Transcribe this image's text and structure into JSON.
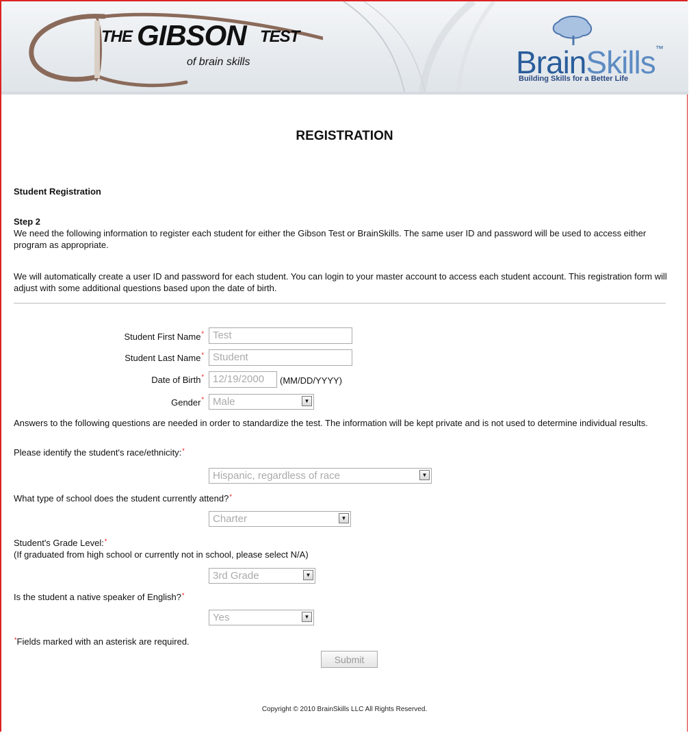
{
  "header": {
    "gibson_the": "THE",
    "gibson_name": "GIBSON",
    "gibson_test": "TEST",
    "gibson_sub": "of brain skills",
    "brainskills_brain": "Brain",
    "brainskills_skills": "Skills",
    "brainskills_tm": "™",
    "brainskills_tagline": "Building Skills for a Better Life"
  },
  "page": {
    "title": "REGISTRATION",
    "section": "Student Registration",
    "step": "Step 2",
    "intro1": "We need the following information to register each student for either the Gibson Test or BrainSkills. The same user ID and password will be used to access either program as appropriate.",
    "intro2": "We will automatically create a user ID and password for each student. You can login to your master account to access each student account. This registration form will adjust with some additional questions based upon the date of birth."
  },
  "form": {
    "first_name": {
      "label": "Student First Name",
      "value": "Test"
    },
    "last_name": {
      "label": "Student Last Name",
      "value": "Student"
    },
    "dob": {
      "label": "Date of Birth",
      "value": "12/19/2000",
      "hint": "(MM/DD/YYYY)"
    },
    "gender": {
      "label": "Gender",
      "value": "Male"
    },
    "note": "Answers to the following questions are needed in order to standardize the test. The information will be kept private and is not used to determine individual results.",
    "race": {
      "label": "Please identify the student's race/ethnicity:",
      "value": "Hispanic, regardless of race"
    },
    "school": {
      "label": "What type of school does the student currently attend?",
      "value": "Charter"
    },
    "grade": {
      "label": "Student's Grade Level:",
      "sublabel": "(If graduated from high school or currently not in school, please select N/A)",
      "value": "3rd Grade"
    },
    "english": {
      "label": "Is the student a native speaker of English?",
      "value": "Yes"
    },
    "required_note": "Fields marked with an asterisk are required.",
    "asterisk": "*",
    "submit_label": "Submit"
  },
  "footer": {
    "copyright": "Copyright © 2010 BrainSkills LLC All Rights Reserved."
  },
  "colors": {
    "border_red": "#dd2222",
    "brand_blue": "#2a5d9b",
    "required_red": "#ee0000"
  }
}
